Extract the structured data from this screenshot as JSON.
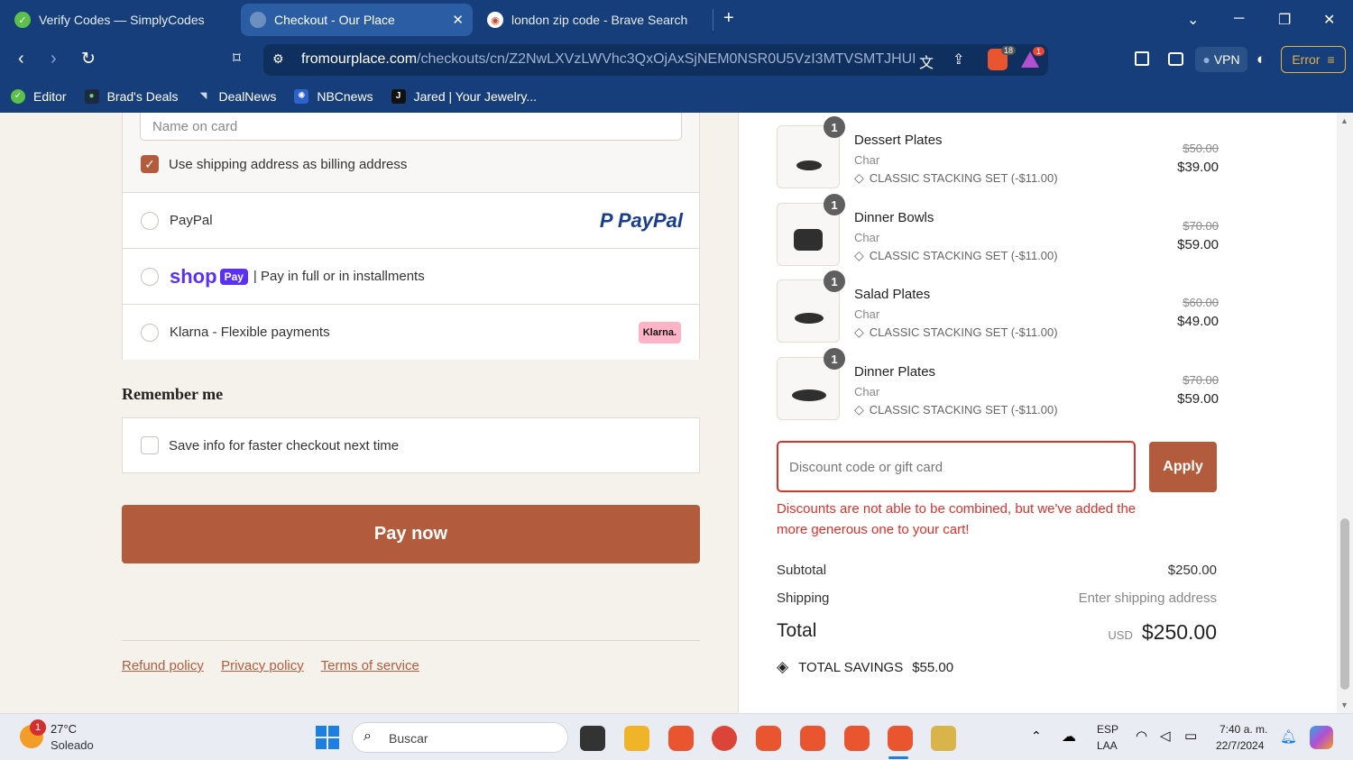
{
  "browser": {
    "tabs": [
      {
        "title": "Verify Codes — SimplyCodes"
      },
      {
        "title": "Checkout - Our Place"
      },
      {
        "title": "london zip code - Brave Search"
      }
    ],
    "url_domain": "fromourplace.com",
    "url_path": "/checkouts/cn/Z2NwLXVzLWVhc3QxOjAxSjNEM0NSR0U5VzI3MTVSMTJHUENO...",
    "shields_count": "18",
    "rewards_count": "1",
    "vpn_label": "VPN",
    "error_label": "Error",
    "bookmarks": [
      {
        "label": "Editor"
      },
      {
        "label": "Brad's Deals"
      },
      {
        "label": "DealNews"
      },
      {
        "label": "NBCnews"
      },
      {
        "label": "Jared | Your Jewelry..."
      }
    ]
  },
  "payment": {
    "name_placeholder": "Name on card",
    "billing_same_label": "Use shipping address as billing address",
    "paypal_label": "PayPal",
    "paypal_logo": "PayPal",
    "shop_logo": "shop",
    "shop_pay_badge": "Pay",
    "shop_label": "| Pay in full or in installments",
    "klarna_label": "Klarna - Flexible payments",
    "klarna_logo": "Klarna."
  },
  "remember": {
    "heading": "Remember me",
    "save_label": "Save info for faster checkout next time"
  },
  "pay_now_label": "Pay now",
  "footer": {
    "refund": "Refund policy",
    "privacy": "Privacy policy",
    "terms": "Terms of service"
  },
  "items": [
    {
      "qty": "1",
      "name": "Dessert Plates",
      "variant": "Char",
      "discount": "CLASSIC STACKING SET (-$11.00)",
      "old_price": "$50.00",
      "price": "$39.00"
    },
    {
      "qty": "1",
      "name": "Dinner Bowls",
      "variant": "Char",
      "discount": "CLASSIC STACKING SET (-$11.00)",
      "old_price": "$70.00",
      "price": "$59.00"
    },
    {
      "qty": "1",
      "name": "Salad Plates",
      "variant": "Char",
      "discount": "CLASSIC STACKING SET (-$11.00)",
      "old_price": "$60.00",
      "price": "$49.00"
    },
    {
      "qty": "1",
      "name": "Dinner Plates",
      "variant": "Char",
      "discount": "CLASSIC STACKING SET (-$11.00)",
      "old_price": "$70.00",
      "price": "$59.00"
    }
  ],
  "discount": {
    "placeholder": "Discount code or gift card",
    "apply_label": "Apply",
    "error": "Discounts are not able to be combined, but we've added the more generous one to your cart!"
  },
  "summary": {
    "subtotal_label": "Subtotal",
    "subtotal_value": "$250.00",
    "shipping_label": "Shipping",
    "shipping_value": "Enter shipping address",
    "total_label": "Total",
    "currency": "USD",
    "total_value": "$250.00",
    "savings_label": "TOTAL SAVINGS",
    "savings_value": "$55.00"
  },
  "taskbar": {
    "weather_temp": "27°C",
    "weather_desc": "Soleado",
    "weather_badge": "1",
    "search_placeholder": "Buscar",
    "lang_top": "ESP",
    "lang_bottom": "LAA",
    "time": "7:40 a. m.",
    "date": "22/7/2024"
  },
  "colors": {
    "accent": "#b25c3d",
    "error": "#d9322a",
    "browser_chrome": "#163e7a"
  }
}
